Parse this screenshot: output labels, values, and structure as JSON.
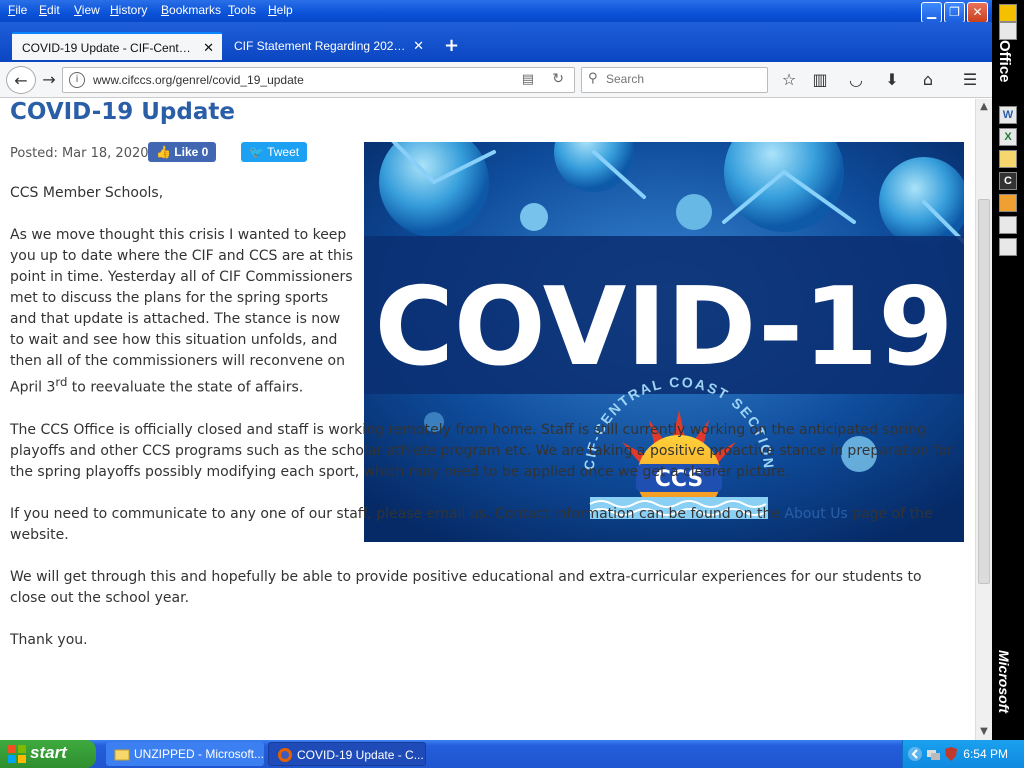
{
  "menubar": {
    "items": [
      "File",
      "Edit",
      "View",
      "History",
      "Bookmarks",
      "Tools",
      "Help"
    ]
  },
  "tabs": [
    {
      "label": "COVID-19 Update - CIF-Central C...",
      "active": true
    },
    {
      "label": "CIF Statement Regarding 2020 Sp...",
      "active": false
    }
  ],
  "navbar": {
    "url": "www.cifccs.org/genrel/covid_19_update",
    "search_placeholder": "Search"
  },
  "article": {
    "title": "COVID-19 Update",
    "posted": "Posted: Mar 18, 2020",
    "like_label": "Like 0",
    "tweet_label": "Tweet",
    "greeting": "CCS Member Schools,",
    "p1_before": "As we move thought this crisis I wanted to keep you up to date where the CIF and CCS are at this point in time. Yesterday all of CIF Commissioners met to discuss the plans for the spring sports and that update is attached. The stance is now to wait and see how this situation unfolds, and then all of the commissioners will reconvene on April 3",
    "p1_sup": "rd",
    "p1_after": " to reevaluate the state of affairs.",
    "p2": "The CCS Office is officially closed and staff is working remotely from home. Staff is still currently working on the anticipated spring playoffs and other CCS programs such as the scholar athlete program etc. We are taking a positive proactive stance in preparation for the spring playoffs possibly modifying each sport, which may need to be applied once we get a clearer picture.",
    "p3_before": "If you need to communicate to any one of our staff, please email us. Contact information can be found on the ",
    "p3_link": "About Us",
    "p3_after": " page of the website.",
    "p4": "We will get through this and hopefully be able to provide positive educational and extra-curricular experiences for our students to close out the school year.",
    "p5": "Thank you."
  },
  "image": {
    "headline": "COVID-19",
    "arc_text": "CIF-CENTRAL COAST SECTION",
    "logo_text": "CCS"
  },
  "officebar": {
    "title": "Office",
    "brand": "Microsoft"
  },
  "taskbar": {
    "start_label": "start",
    "items": [
      {
        "label": "UNZIPPED - Microsoft..."
      },
      {
        "label": "COVID-19 Update - C..."
      }
    ],
    "clock": "6:54 PM"
  },
  "colors": {
    "title_blue": "#2a5fa8",
    "xp_blue": "#0a52d8",
    "start_green": "#3eab3e"
  }
}
